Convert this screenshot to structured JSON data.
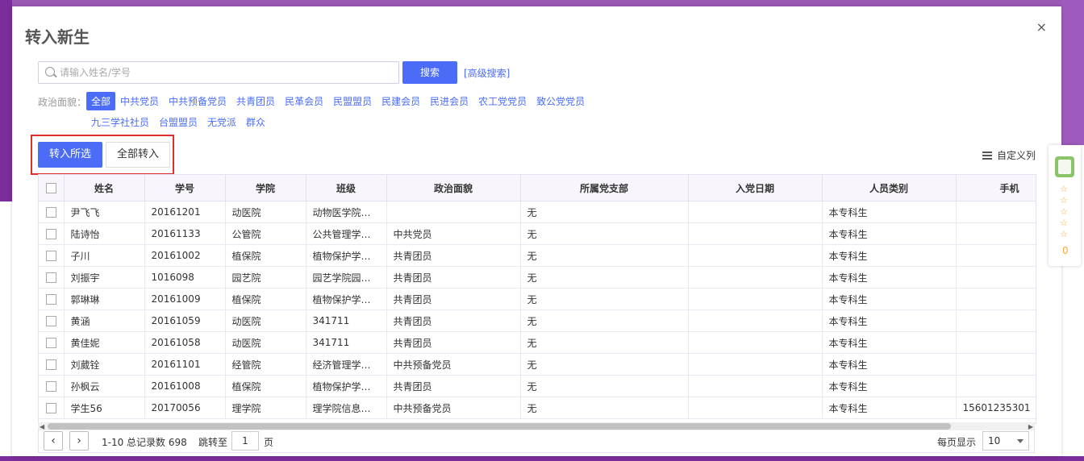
{
  "dialog": {
    "title": "转入新生",
    "close_glyph": "×"
  },
  "search": {
    "placeholder": "请输入姓名/学号",
    "button_label": "搜索",
    "advanced_label": "[高级搜索]"
  },
  "filter": {
    "label": "政治面貌：",
    "options_row1": [
      "全部",
      "中共党员",
      "中共预备党员",
      "共青团员",
      "民革会员",
      "民盟盟员",
      "民建会员",
      "民进会员",
      "农工党党员",
      "致公党党员"
    ],
    "options_row2": [
      "九三学社社员",
      "台盟盟员",
      "无党派",
      "群众"
    ],
    "active": "全部"
  },
  "actions": {
    "transfer_selected": "转入所选",
    "transfer_all": "全部转入",
    "custom_columns": "自定义列"
  },
  "table": {
    "columns": [
      "姓名",
      "学号",
      "学院",
      "班级",
      "政治面貌",
      "所属党支部",
      "入党日期",
      "人员类别",
      "手机"
    ],
    "rows": [
      [
        "尹飞飞",
        "20161201",
        "动医院",
        "动物医学院动…",
        "",
        "无",
        "",
        "本专科生",
        ""
      ],
      [
        "陆诗怡",
        "20161133",
        "公管院",
        "公共管理学院…",
        "中共党员",
        "无",
        "",
        "本专科生",
        ""
      ],
      [
        "子川",
        "20161002",
        "植保院",
        "植物保护学院…",
        "共青团员",
        "无",
        "",
        "本专科生",
        ""
      ],
      [
        "刘振宇",
        "1016098",
        "园艺院",
        "园艺学院园艺…",
        "共青团员",
        "无",
        "",
        "本专科生",
        ""
      ],
      [
        "郭琳琳",
        "20161009",
        "植保院",
        "植物保护学院…",
        "共青团员",
        "无",
        "",
        "本专科生",
        ""
      ],
      [
        "黄涵",
        "20161059",
        "动医院",
        "341711",
        "共青团员",
        "无",
        "",
        "本专科生",
        ""
      ],
      [
        "黄佳妮",
        "20161058",
        "动医院",
        "341711",
        "共青团员",
        "无",
        "",
        "本专科生",
        ""
      ],
      [
        "刘葳铨",
        "20161101",
        "经管院",
        "经济管理学院…",
        "中共预备党员",
        "无",
        "",
        "本专科生",
        ""
      ],
      [
        "孙枫云",
        "20161008",
        "植保院",
        "植物保护学院…",
        "共青团员",
        "无",
        "",
        "本专科生",
        ""
      ],
      [
        "学生56",
        "20170056",
        "理学院",
        "理学院信息与…",
        "中共预备党员",
        "无",
        "",
        "本专科生",
        "15601235301"
      ]
    ]
  },
  "pager": {
    "prev": "‹",
    "next": "›",
    "info": "1-10 总记录数 698",
    "jump_label": "跳转至",
    "jump_value": "1",
    "page_unit": "页",
    "per_page_label": "每页显示",
    "per_page_value": "10"
  },
  "side_widget": {
    "stars": "☆☆☆☆☆",
    "count": "0"
  },
  "colors": {
    "accent": "#4a6cf7",
    "frame": "#e22d2d",
    "backdrop": "#7b2d9c"
  }
}
